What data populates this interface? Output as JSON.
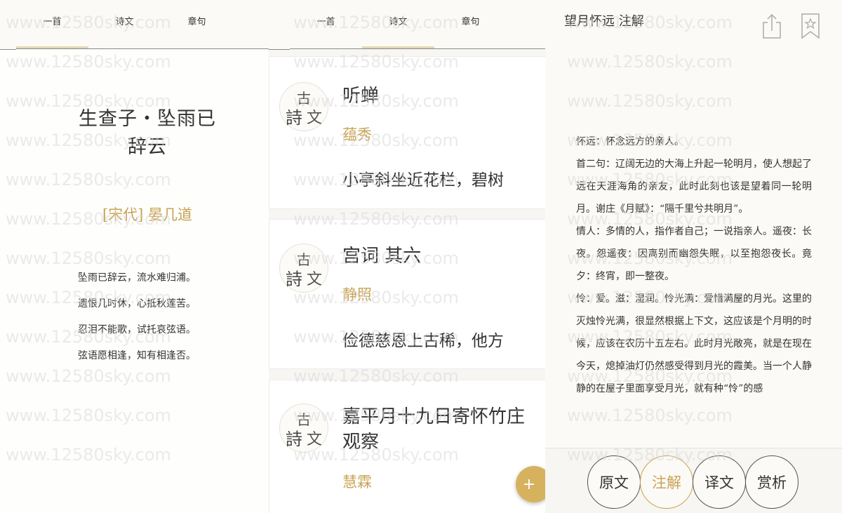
{
  "panel1": {
    "tabs": [
      {
        "label": "一首",
        "active": true
      },
      {
        "label": "诗文",
        "active": false
      },
      {
        "label": "章句",
        "active": false
      }
    ],
    "title_line1": "生查子・坠雨已",
    "title_line2": "辞云",
    "author": "[宋代] 晏几道",
    "lines": [
      "坠雨已辞云，流水难归浦。",
      "遗恨几时休，心抵秋莲苦。",
      "忍泪不能歌，试托哀弦语。",
      "弦语愿相逢，知有相逢否。"
    ]
  },
  "panel2": {
    "tabs": [
      {
        "label": "一首",
        "active": false
      },
      {
        "label": "诗文",
        "active": true
      },
      {
        "label": "章句",
        "active": false
      }
    ],
    "seal": {
      "top": "古",
      "left": "詩",
      "right": "文"
    },
    "cards": [
      {
        "title": "听蝉",
        "author": "蕴秀",
        "excerpt": "小亭斜坐近花栏，碧树"
      },
      {
        "title": "宫词 其六",
        "author": "静照",
        "excerpt": "俭德慈恩上古稀，他方"
      },
      {
        "title": "嘉平月十九日寄怀竹庄观察",
        "author": "慧霖",
        "excerpt": ""
      }
    ],
    "fab_label": "+"
  },
  "panel3": {
    "title": "望月怀远 注解",
    "share_icon": "share-icon",
    "bookmark_icon": "bookmark-star-icon",
    "notes": [
      "怀远：怀念远方的亲人。",
      "首二句：辽阔无边的大海上升起一轮明月，使人想起了远在天涯海角的亲友，此时此刻也该是望着同一轮明月。谢庄《月赋》：“隔千里兮共明月”。",
      "情人：多情的人，指作者自己；一说指亲人。遥夜：长夜。怨遥夜：因离别而幽怨失眠，以至抱怨夜长。竟夕：终宵，即一整夜。",
      "怜：爱。滋：湿润。怜光满：爱惜满屋的月光。这里的灭烛怜光满，很显然根据上下文，这应该是个月明的时候，应该在农历十五左右。此时月光敞亮，就是在现在今天，熄掉油灯仍然感受得到月光的霞美。当一个人静静的在屋子里面享受月光，就有种“怜”的感"
    ],
    "buttons": [
      {
        "label": "原文",
        "active": false
      },
      {
        "label": "注解",
        "active": true
      },
      {
        "label": "译文",
        "active": false
      },
      {
        "label": "赏析",
        "active": false
      }
    ]
  },
  "watermark": "www.12580sky.com",
  "colors": {
    "gold": "#c9a355",
    "fab": "#d6b25f",
    "text": "#333333"
  }
}
